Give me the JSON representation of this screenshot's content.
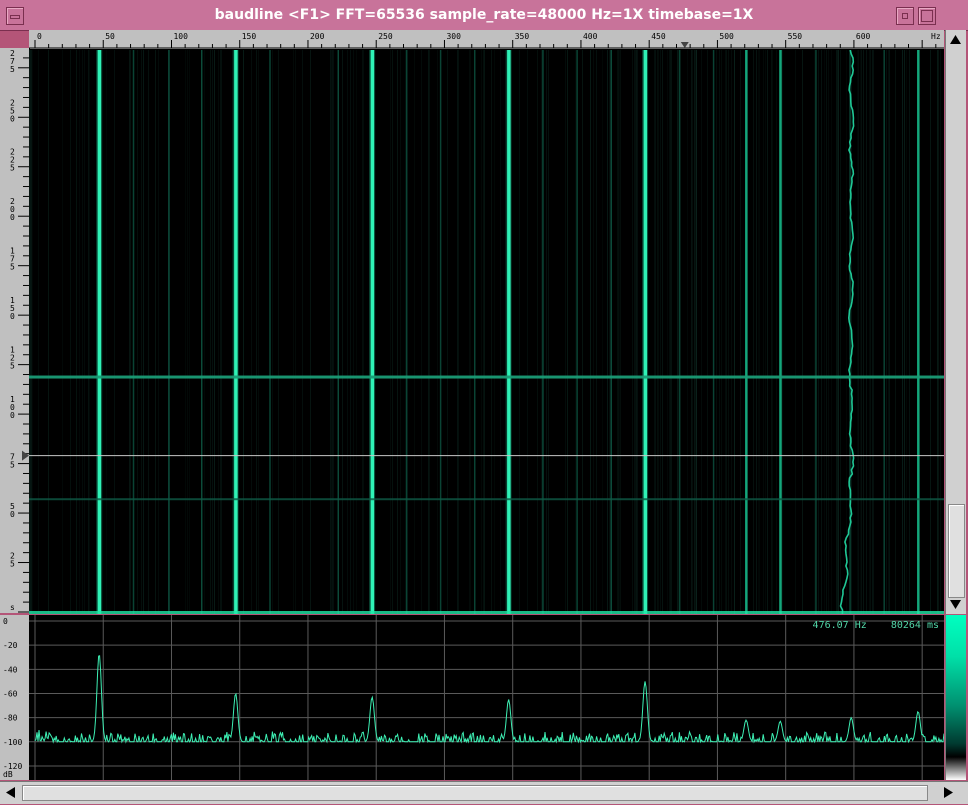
{
  "window": {
    "title": "baudline  <F1> FFT=65536 sample_rate=48000 Hz=1X timebase=1X"
  },
  "ruler": {
    "ticks": [
      "0",
      "50",
      "100",
      "150",
      "200",
      "250",
      "300",
      "350",
      "400",
      "450",
      "500",
      "550",
      "600",
      "Hz"
    ]
  },
  "time_axis": {
    "labels": [
      "275",
      "250",
      "225",
      "200",
      "175",
      "150",
      "125",
      "100",
      "75",
      "50",
      "25",
      "s"
    ]
  },
  "readout": {
    "frequency": "476.07 Hz",
    "time": "80264 ms"
  },
  "spectrum_axis": {
    "labels": [
      "0",
      "-20",
      "-40",
      "-60",
      "-80",
      "-100",
      "-120",
      "dB"
    ]
  },
  "colors": {
    "trace": "#3df0b4",
    "line_bright": "#1fe8a8",
    "window_frame": "#b45578",
    "titlebar": "#c8739a"
  },
  "chart_data": [
    {
      "type": "heatmap",
      "xlim": [
        0,
        666
      ],
      "xlabel": "Hz",
      "ylim": [
        0,
        285
      ],
      "ylabel": "s",
      "grid": false,
      "bright_lines_hz": [
        47,
        147,
        247,
        347,
        447
      ],
      "medium_lines_hz": [
        521,
        546,
        647
      ],
      "faint_lines_hz": [
        72,
        98,
        122,
        172,
        222,
        272,
        297,
        322,
        372,
        397,
        422,
        472,
        497,
        572,
        597,
        622
      ],
      "wandering_line_hz": 598,
      "horizontal_events_s": [
        120,
        58
      ],
      "cursor_time_s": 80
    },
    {
      "type": "line",
      "xlim": [
        0,
        666
      ],
      "ylim": [
        -125,
        0
      ],
      "ylabel": "dB",
      "grid": true,
      "noise_floor_db": -100,
      "peaks": [
        {
          "x": 47,
          "y": -27
        },
        {
          "x": 147,
          "y": -60
        },
        {
          "x": 247,
          "y": -63
        },
        {
          "x": 347,
          "y": -65
        },
        {
          "x": 447,
          "y": -50
        },
        {
          "x": 521,
          "y": -82
        },
        {
          "x": 546,
          "y": -83
        },
        {
          "x": 598,
          "y": -80
        },
        {
          "x": 647,
          "y": -75
        }
      ]
    }
  ]
}
